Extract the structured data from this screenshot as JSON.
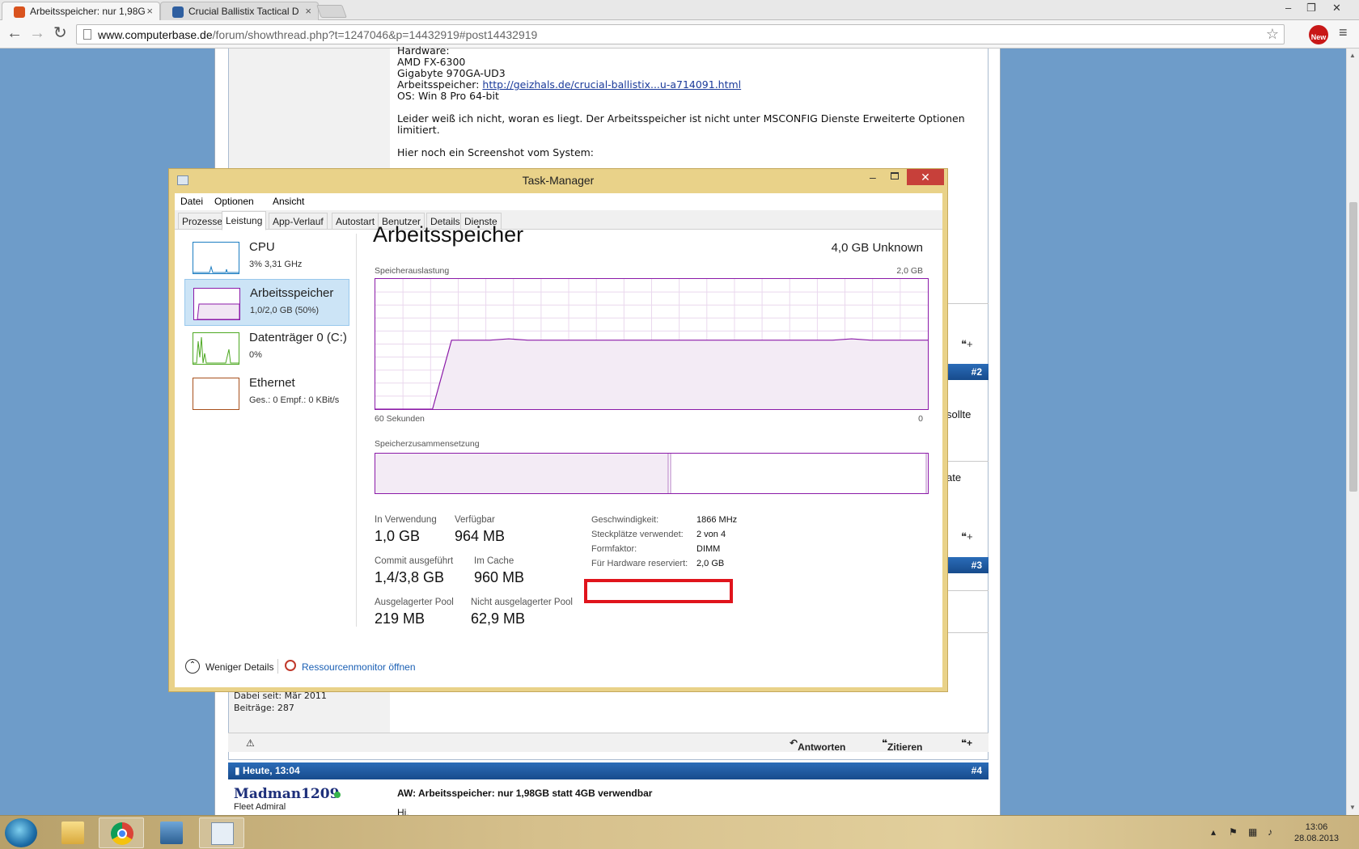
{
  "browser": {
    "tabs": [
      {
        "title": "Arbeitsspeicher: nur 1,98G",
        "active": true
      },
      {
        "title": "Crucial Ballistix Tactical D",
        "active": false
      }
    ],
    "url_host": "www.computerbase.de",
    "url_path": "/forum/showthread.php?t=1247046&p=14432919#post14432919",
    "extension_badge": "New"
  },
  "forum": {
    "post_lines": {
      "hardware": "Hardware:",
      "cpu": "AMD FX-6300",
      "board": "Gigabyte 970GA-UD3",
      "ram_label": "Arbeitsspeicher:",
      "ram_link": "http://geizhals.de/crucial-ballistix...u-a714091.html",
      "os": "OS: Win 8 Pro 64-bit",
      "problem": "Leider weiß ich nicht, woran es liegt. Der Arbeitsspeicher ist nicht unter MSCONFIG Dienste Erweiterte Optionen limitiert.",
      "screenshot_note": "Hier noch ein Screenshot vom System:"
    },
    "post_numbers": [
      "#2",
      "#3",
      "#4"
    ],
    "partial_texts": [
      "sollte",
      "ate"
    ],
    "user_since": "Dabei seit: Mär 2011",
    "user_posts": "Beiträge: 287",
    "actions": {
      "reply": "Antworten",
      "quote": "Zitieren"
    },
    "post4": {
      "date": "Heute, 13:04",
      "username": "Madman1209",
      "user_rank": "Fleet Admiral",
      "title": "AW: Arbeitsspeicher: nur 1,98GB statt 4GB verwendbar",
      "greeting": "Hi,"
    }
  },
  "taskmanager": {
    "title": "Task-Manager",
    "menu": [
      "Datei",
      "Optionen",
      "Ansicht"
    ],
    "tabs": [
      "Prozesse",
      "Leistung",
      "App-Verlauf",
      "Autostart",
      "Benutzer",
      "Details",
      "Dienste"
    ],
    "active_tab": "Leistung",
    "sidebar": [
      {
        "name": "CPU",
        "value": "3% 3,31 GHz",
        "color": "#1c7dc2"
      },
      {
        "name": "Arbeitsspeicher",
        "value": "1,0/2,0 GB (50%)",
        "color": "#8b1aa8"
      },
      {
        "name": "Datenträger 0 (C:)",
        "value": "0%",
        "color": "#4da822"
      },
      {
        "name": "Ethernet",
        "value": "Ges.: 0 Empf.: 0 KBit/s",
        "color": "#a7501c"
      }
    ],
    "heading": "Arbeitsspeicher",
    "capacity": "4,0 GB Unknown",
    "usage_label": "Speicherauslastung",
    "usage_max": "2,0 GB",
    "time_left": "60 Sekunden",
    "time_right": "0",
    "composition_label": "Speicherzusammensetzung",
    "usage_fraction_series": [
      0,
      0,
      0,
      0,
      0.53,
      0.53,
      0.53,
      0.54,
      0.53,
      0.53,
      0.53,
      0.53,
      0.53,
      0.53,
      0.53,
      0.53,
      0.53,
      0.53,
      0.53,
      0.53,
      0.53,
      0.53,
      0.53,
      0.53,
      0.53,
      0.54,
      0.53,
      0.53,
      0.53,
      0.53
    ],
    "composition_in_use_fraction": 0.53,
    "stats": {
      "in_use_label": "In Verwendung",
      "in_use": "1,0 GB",
      "available_label": "Verfügbar",
      "available": "964 MB",
      "committed_label": "Commit ausgeführt",
      "committed": "1,4/3,8 GB",
      "cached_label": "Im Cache",
      "cached": "960 MB",
      "paged_label": "Ausgelagerter Pool",
      "paged": "219 MB",
      "nonpaged_label": "Nicht ausgelagerter Pool",
      "nonpaged": "62,9 MB"
    },
    "details": [
      {
        "key": "Geschwindigkeit:",
        "value": "1866 MHz"
      },
      {
        "key": "Steckplätze verwendet:",
        "value": "2 von 4"
      },
      {
        "key": "Formfaktor:",
        "value": "DIMM"
      },
      {
        "key": "Für Hardware reserviert:",
        "value": "2,0 GB"
      }
    ],
    "fewer_details": "Weniger Details",
    "resource_monitor": "Ressourcenmonitor öffnen"
  },
  "taskbar": {
    "clock_time": "13:06",
    "clock_date": "28.08.2013"
  }
}
